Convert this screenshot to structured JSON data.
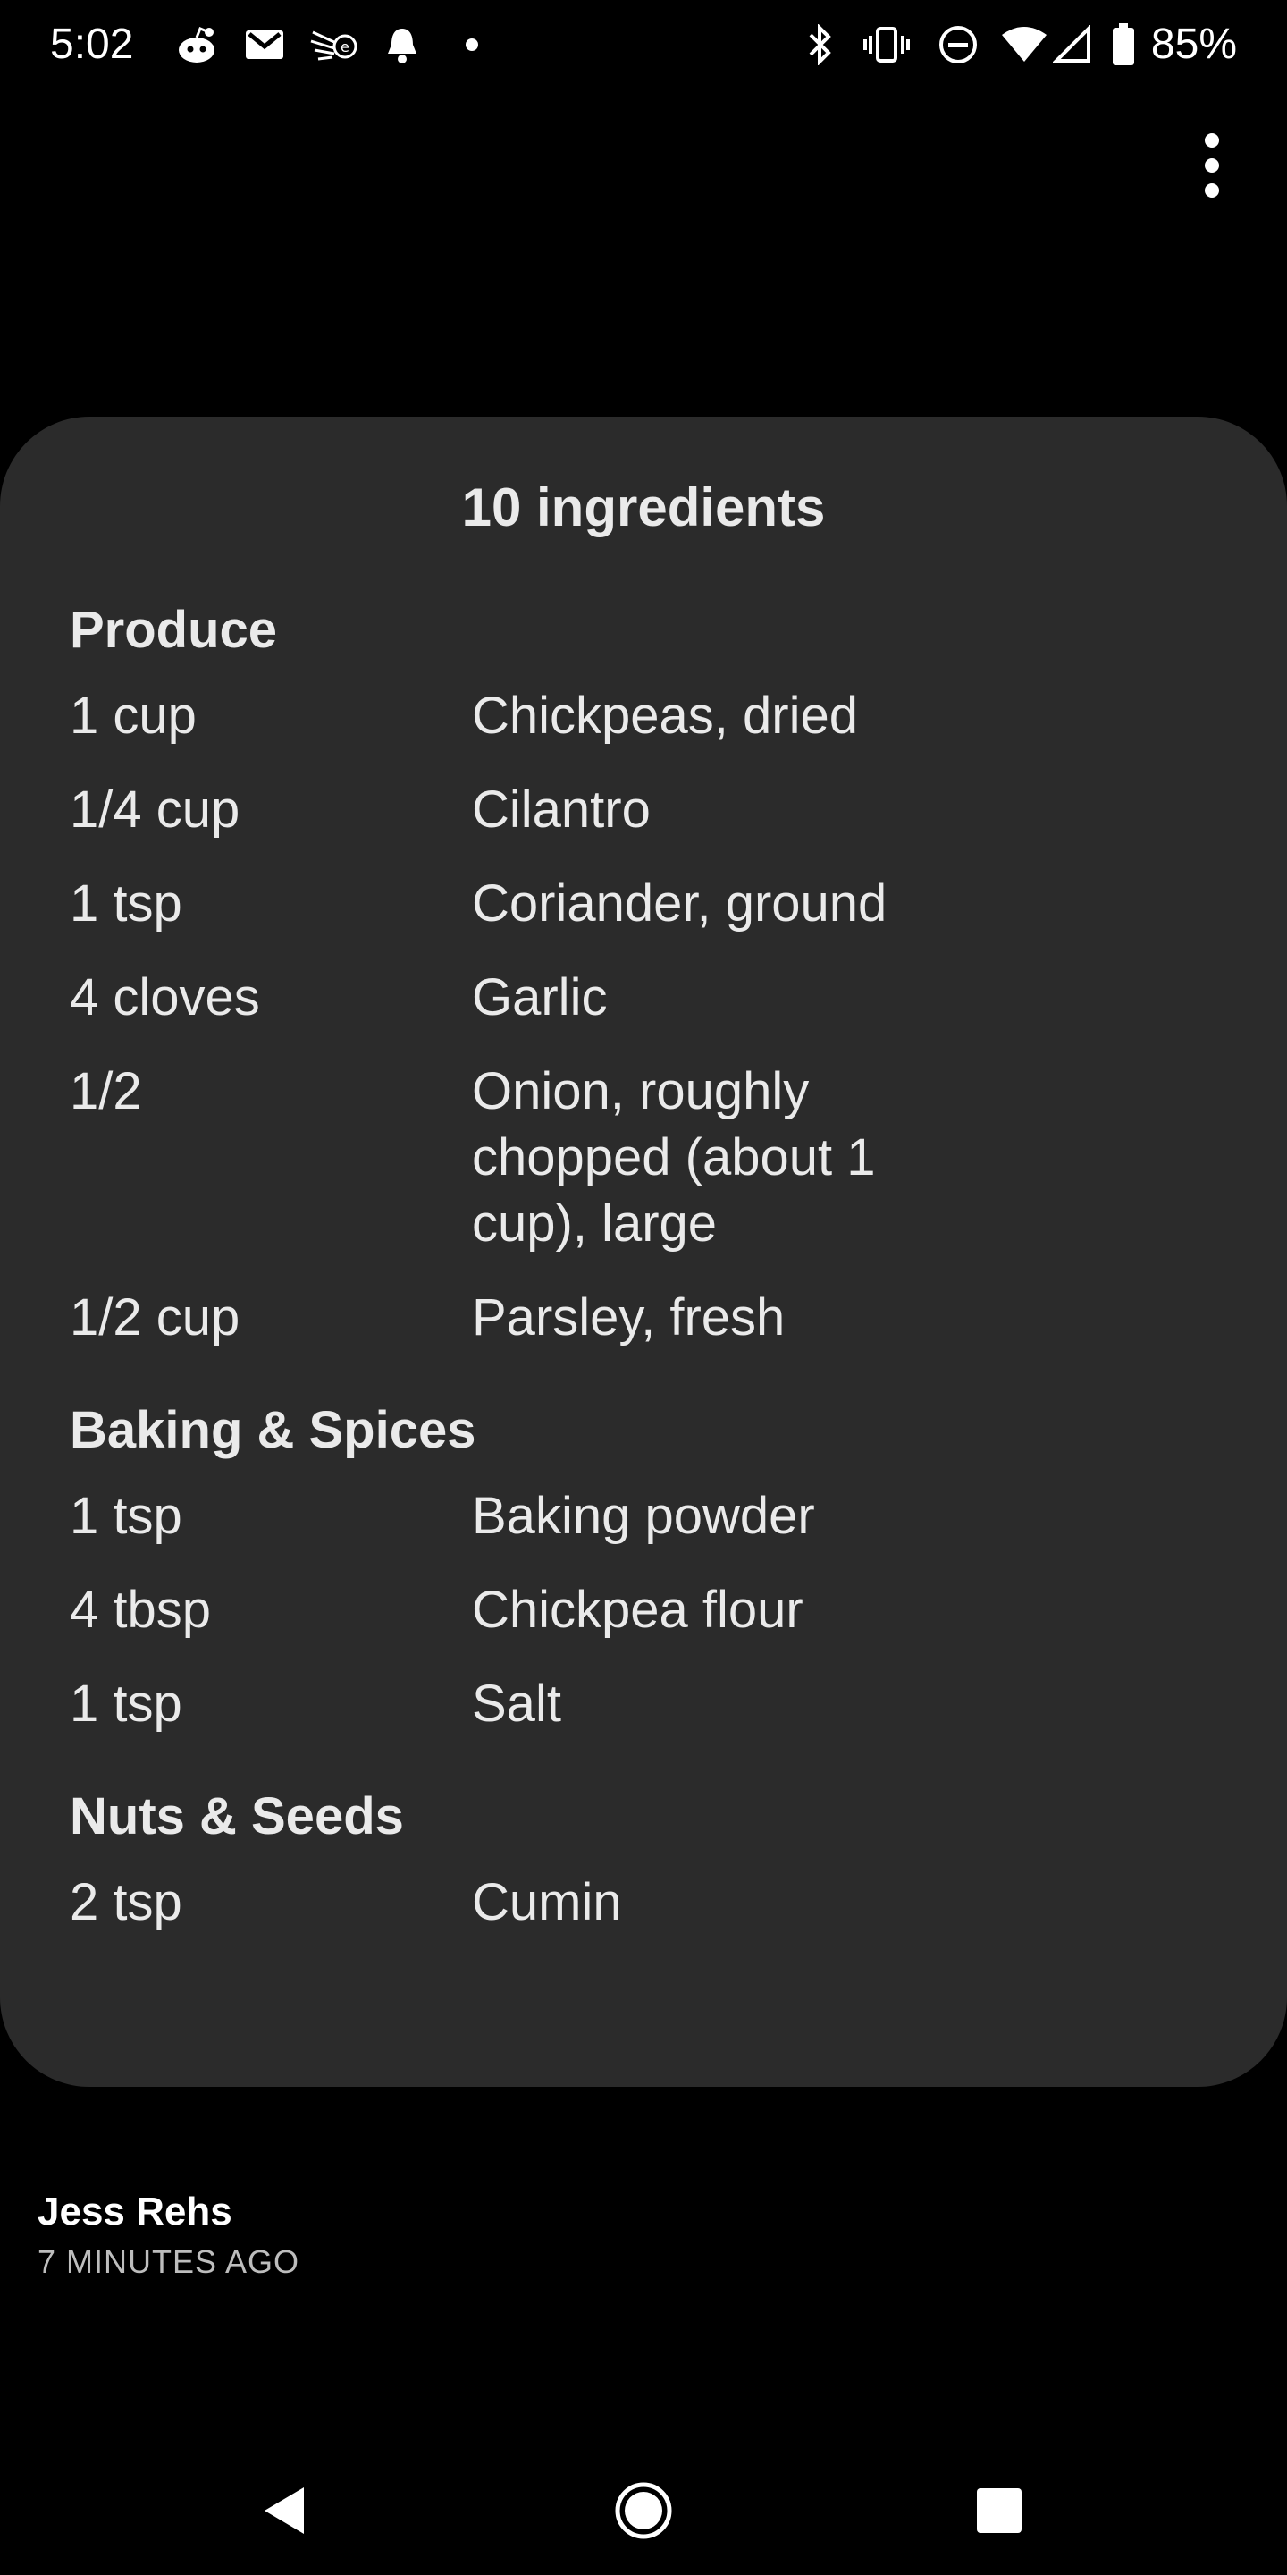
{
  "status_bar": {
    "time": "5:02",
    "battery_percent": "85%",
    "icons": [
      "reddit-icon",
      "gmail-icon",
      "app-icon",
      "bell-icon",
      "dot-icon",
      "bluetooth-icon",
      "vibrate-icon",
      "do-not-disturb-icon",
      "wifi-icon",
      "signal-icon",
      "battery-icon"
    ]
  },
  "card": {
    "title": "10 ingredients",
    "sections": [
      {
        "heading": "Produce",
        "items": [
          {
            "qty": "1 cup",
            "name": "Chickpeas, dried"
          },
          {
            "qty": "1/4 cup",
            "name": "Cilantro"
          },
          {
            "qty": "1 tsp",
            "name": "Coriander, ground"
          },
          {
            "qty": "4 cloves",
            "name": "Garlic"
          },
          {
            "qty": "1/2",
            "name": "Onion, roughly chopped (about 1 cup), large"
          },
          {
            "qty": "1/2 cup",
            "name": "Parsley, fresh"
          }
        ]
      },
      {
        "heading": "Baking & Spices",
        "items": [
          {
            "qty": "1 tsp",
            "name": "Baking powder"
          },
          {
            "qty": "4 tbsp",
            "name": "Chickpea flour"
          },
          {
            "qty": "1 tsp",
            "name": "Salt"
          }
        ]
      },
      {
        "heading": "Nuts & Seeds",
        "items": [
          {
            "qty": "2 tsp",
            "name": "Cumin"
          }
        ]
      }
    ]
  },
  "post": {
    "author": "Jess Rehs",
    "timestamp": "7 MINUTES AGO"
  },
  "colors": {
    "background": "#000000",
    "card": "#2b2b2b",
    "text": "#eaeaea",
    "muted": "#bdbdbd"
  }
}
